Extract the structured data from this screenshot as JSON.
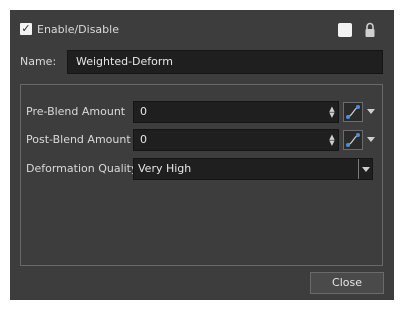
{
  "header": {
    "enable_checked_glyph": "✓",
    "enable_label": "Enable/Disable",
    "color_icon": "color-swatch",
    "lock_icon": "lock-icon"
  },
  "name": {
    "label": "Name:",
    "value": "Weighted-Deform"
  },
  "params": {
    "pre_blend": {
      "label": "Pre-Blend Amount",
      "value": "0",
      "spin_glyph": "▲▼"
    },
    "post_blend": {
      "label": "Post-Blend Amount",
      "value": "0",
      "spin_glyph": "▲▼"
    },
    "deformation_quality": {
      "label": "Deformation Quality",
      "value": "Very High"
    }
  },
  "footer": {
    "close_label": "Close"
  },
  "colors": {
    "dialog_bg": "#3d3d3d",
    "field_bg": "#1f1f1f",
    "accent_blue": "#4a90d9"
  }
}
